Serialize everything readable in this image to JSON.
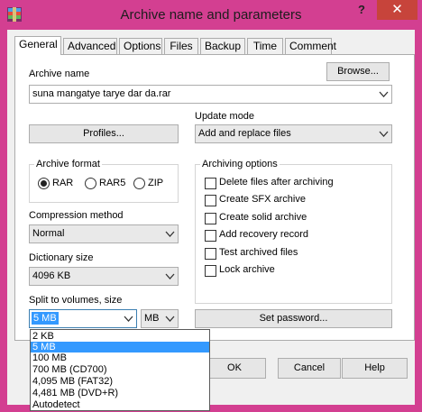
{
  "window": {
    "title": "Archive name and parameters",
    "help": "?",
    "close": "✕",
    "icon": "winrar-archive-icon"
  },
  "tabs": [
    {
      "label": "General",
      "active": true
    },
    {
      "label": "Advanced"
    },
    {
      "label": "Options"
    },
    {
      "label": "Files"
    },
    {
      "label": "Backup"
    },
    {
      "label": "Time"
    },
    {
      "label": "Comment"
    }
  ],
  "archive_name": {
    "label": "Archive name",
    "value": "suna mangatye tarye dar da.rar",
    "browse": "Browse..."
  },
  "profiles": {
    "label": "Profiles..."
  },
  "update_mode": {
    "label": "Update mode",
    "value": "Add and replace files"
  },
  "archive_format": {
    "label": "Archive format",
    "options": [
      "RAR",
      "RAR5",
      "ZIP"
    ],
    "selected": "RAR"
  },
  "compression": {
    "label": "Compression method",
    "value": "Normal"
  },
  "dictionary": {
    "label": "Dictionary size",
    "value": "4096 KB"
  },
  "split": {
    "label": "Split to volumes, size",
    "value": "5 MB",
    "unit": "MB"
  },
  "split_options": [
    "2 KB",
    "5 MB",
    "100 MB",
    "700 MB  (CD700)",
    "4,095 MB  (FAT32)",
    "4,481 MB  (DVD+R)",
    "Autodetect"
  ],
  "split_selected": "5 MB",
  "archiving_options": {
    "label": "Archiving options",
    "items": [
      {
        "label": "Delete files after archiving",
        "checked": false
      },
      {
        "label": "Create SFX archive",
        "checked": false
      },
      {
        "label": "Create solid archive",
        "checked": false
      },
      {
        "label": "Add recovery record",
        "checked": false
      },
      {
        "label": "Test archived files",
        "checked": false
      },
      {
        "label": "Lock archive",
        "checked": false
      }
    ]
  },
  "set_password": "Set password...",
  "footer": {
    "ok": "OK",
    "cancel": "Cancel",
    "help": "Help"
  },
  "colors": {
    "titlebar": "#d33f91",
    "close": "#c7443b",
    "highlight": "#3399ff"
  }
}
